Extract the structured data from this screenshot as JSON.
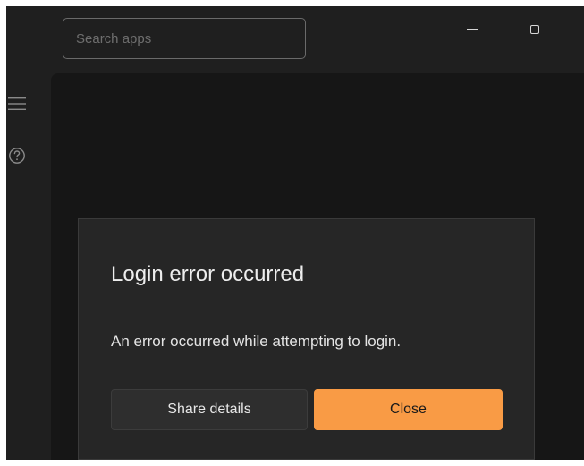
{
  "search": {
    "placeholder": "Search apps"
  },
  "window_controls": {
    "minimize_icon": "minimize-icon",
    "maximize_icon": "maximize-icon"
  },
  "sidebar": {
    "icons": [
      "hamburger-menu-icon",
      "help-icon"
    ]
  },
  "dialog": {
    "title": "Login error occurred",
    "message": "An error occurred while attempting to login.",
    "share_label": "Share details",
    "close_label": "Close"
  },
  "colors": {
    "background": "#1f1f1f",
    "dialog_background": "#262626",
    "accent": "#f99b45",
    "secondary_button": "#2e2e2e"
  }
}
